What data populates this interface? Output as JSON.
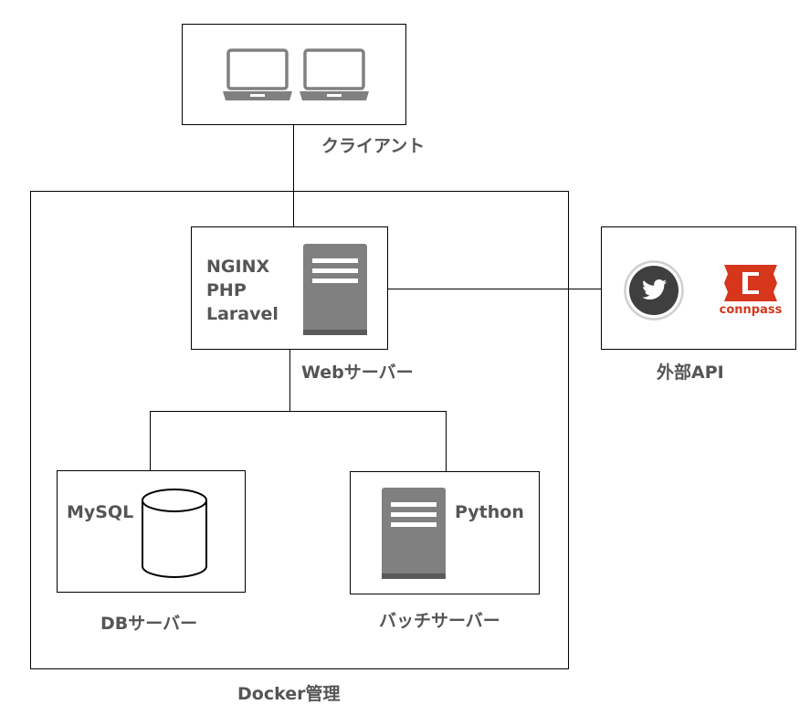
{
  "client": {
    "label": "クライアント",
    "icons": [
      "laptop-icon",
      "laptop-icon"
    ]
  },
  "web_server": {
    "label": "Webサーバー",
    "stack": [
      "NGINX",
      "PHP",
      "Laravel"
    ],
    "icon": "server-icon"
  },
  "external_api": {
    "label": "外部API",
    "icons": [
      "twitter-icon",
      "connpass-logo"
    ],
    "connpass_text": "connpass"
  },
  "db_server": {
    "label": "DBサーバー",
    "stack": [
      "MySQL"
    ],
    "icon": "database-icon"
  },
  "batch_server": {
    "label": "バッチサーバー",
    "stack": [
      "Python"
    ],
    "icon": "server-icon"
  },
  "docker": {
    "label": "Docker管理"
  },
  "colors": {
    "icon_gray": "#808080",
    "icon_dark": "#5a5a5a",
    "twitter_gray": "#3f3f3f",
    "connpass_red": "#d5361c",
    "label_text": "#555555"
  }
}
